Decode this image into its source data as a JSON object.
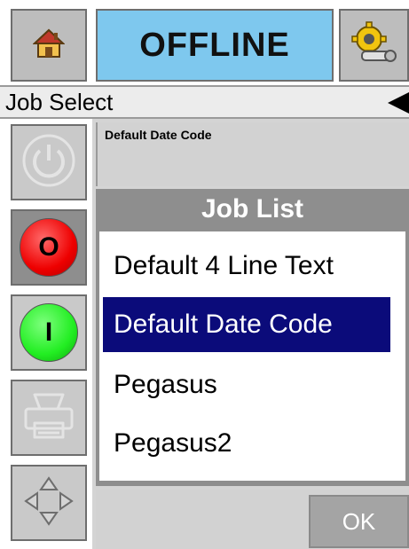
{
  "header": {
    "home_icon": "home-icon",
    "status": "OFFLINE",
    "status_color": "#7ec8ee",
    "settings_icon": "settings-gear-icon"
  },
  "breadcrumb": {
    "title": "Job Select",
    "back_icon": "back-arrow-icon"
  },
  "sidebar": {
    "power_icon": "power-icon",
    "stop_label": "O",
    "stop_color": "#ee0000",
    "start_label": "I",
    "start_color": "#22ee22",
    "printer_icon": "printer-icon",
    "nav_icon": "direction-pad-icon"
  },
  "job_info": {
    "current_job": "Default Date Code"
  },
  "job_list": {
    "title": "Job List",
    "items": [
      {
        "label": "Default 4 Line Text",
        "selected": false
      },
      {
        "label": "Default Date Code",
        "selected": true
      },
      {
        "label": "Pegasus",
        "selected": false
      },
      {
        "label": "Pegasus2",
        "selected": false
      }
    ],
    "selection_color": "#0b0b7a"
  },
  "footer": {
    "ok_label": "OK"
  }
}
